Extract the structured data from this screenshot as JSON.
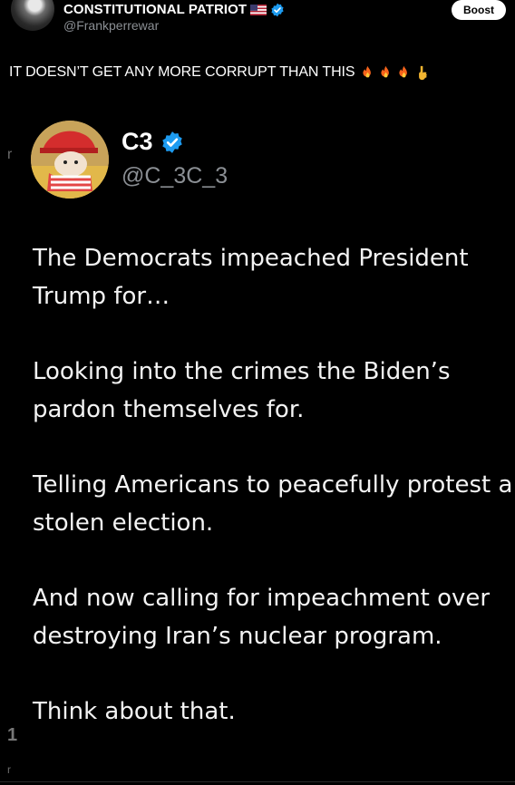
{
  "post": {
    "author_name": "CONSTITUTIONAL PATRIOT",
    "author_handle": "@Frankperrewar",
    "boost_label": "Boost",
    "text": "IT DOESN’T GET ANY MORE CORRUPT THAN THIS",
    "emojis": [
      "fire-icon",
      "fire-icon",
      "fire-icon",
      "pointing-down-icon"
    ]
  },
  "quote": {
    "name": "C3",
    "handle": "@C_3C_3",
    "paragraphs": [
      "The Democrats impeached President Trump for…",
      "Looking into the crimes the Biden’s pardon themselves for.",
      "Telling Americans to peacefully protest a stolen election.",
      "And now calling for impeachment over destroying Iran’s nuclear program.",
      "Think about that."
    ]
  },
  "side_marks": [
    "r",
    "1",
    "r"
  ],
  "colors": {
    "background": "#000000",
    "verified_blue": "#1d9bf0",
    "handle_gray": "#8b8f94"
  }
}
